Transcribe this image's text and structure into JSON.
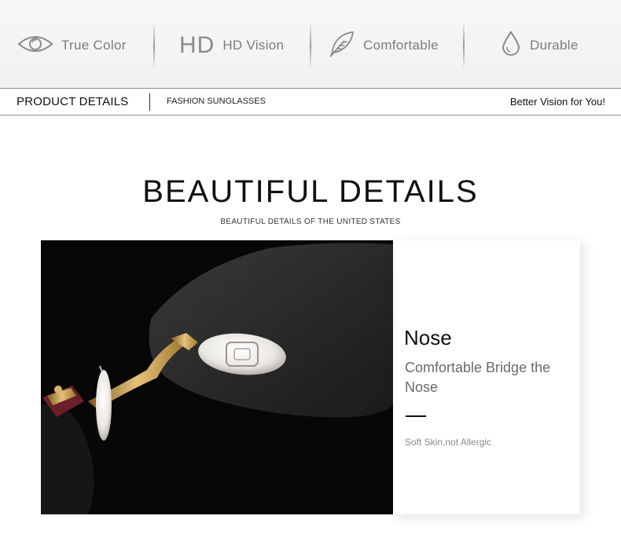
{
  "features": [
    {
      "icon": "eye-icon",
      "label": "True Color"
    },
    {
      "icon": "hd-icon",
      "mark": "HD",
      "label": "HD Vision"
    },
    {
      "icon": "feather-icon",
      "label": "Comfortable"
    },
    {
      "icon": "drop-icon",
      "label": "Durable"
    }
  ],
  "strip": {
    "title": "PRODUCT DETAILS",
    "category": "FASHION SUNGLASSES",
    "slogan": "Better Vision for You!"
  },
  "section": {
    "heading": "BEAUTIFUL DETAILS",
    "subheading": "BEAUTIFUL DETAILS OF THE UNITED STATES"
  },
  "detail": {
    "title": "Nose",
    "description": "Comfortable Bridge the Nose",
    "note": "Soft Skin,not Allergic"
  },
  "colors": {
    "icon_gray": "#8a8a8a",
    "photo_background": "#070707",
    "gold": "#c9a24a"
  }
}
